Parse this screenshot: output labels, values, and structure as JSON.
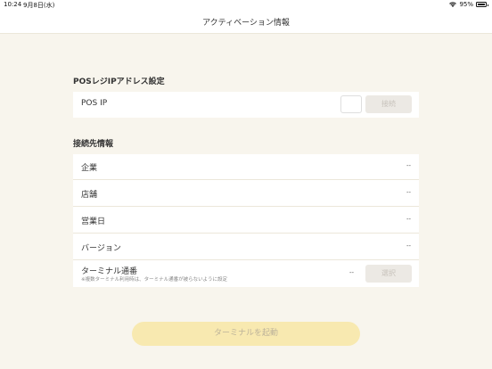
{
  "status_bar": {
    "time": "10:24",
    "date": "9月8日(水)",
    "battery_percent": "95%"
  },
  "header": {
    "title": "アクティベーション情報"
  },
  "pos_section": {
    "title": "POSレジIPアドレス設定",
    "ip_label": "POS IP",
    "ip_value": "",
    "connect_label": "接続"
  },
  "connection_section": {
    "title": "接続先情報",
    "rows": [
      {
        "label": "企業",
        "value": "--"
      },
      {
        "label": "店舗",
        "value": "--"
      },
      {
        "label": "営業日",
        "value": "--"
      },
      {
        "label": "バージョン",
        "value": "--"
      }
    ],
    "terminal": {
      "label": "ターミナル通番",
      "note": "※複数ターミナル利用時は、ターミナル通番が被らないように設定",
      "value": "--",
      "select_label": "選択"
    }
  },
  "footer": {
    "start_label": "ターミナルを起動"
  },
  "colors": {
    "background": "#f8f5ed",
    "card": "#ffffff",
    "disabled_button": "#ece9e4",
    "start_button": "#f8e9b0"
  }
}
